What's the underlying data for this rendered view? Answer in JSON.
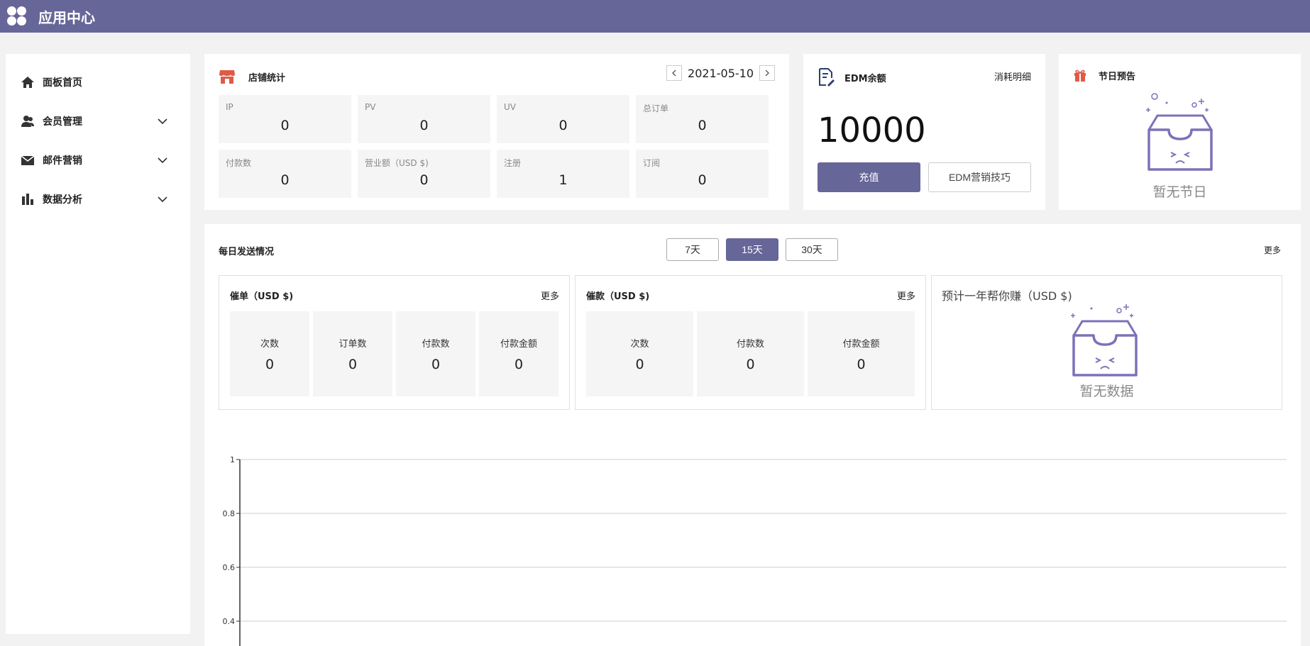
{
  "app": {
    "title": "应用中心"
  },
  "sidebar": {
    "items": [
      {
        "label": "面板首页",
        "icon": "home-icon",
        "expandable": false
      },
      {
        "label": "会员管理",
        "icon": "members-icon",
        "expandable": true
      },
      {
        "label": "邮件营销",
        "icon": "mail-icon",
        "expandable": true
      },
      {
        "label": "数据分析",
        "icon": "bar-chart-icon",
        "expandable": true
      }
    ]
  },
  "store_stats": {
    "title": "店铺统计",
    "date": "2021-05-10",
    "stats": [
      {
        "label": "IP",
        "value": "0"
      },
      {
        "label": "PV",
        "value": "0"
      },
      {
        "label": "UV",
        "value": "0"
      },
      {
        "label": "总订单",
        "value": "0"
      },
      {
        "label": "付款数",
        "value": "0"
      },
      {
        "label": "营业额（USD $)",
        "value": "0"
      },
      {
        "label": "注册",
        "value": "1"
      },
      {
        "label": "订阅",
        "value": "0"
      }
    ]
  },
  "edm": {
    "title": "EDM余额",
    "detail_link": "消耗明细",
    "balance": "10000",
    "recharge_label": "充值",
    "tips_label": "EDM营销技巧"
  },
  "holiday": {
    "title": "节日预告",
    "empty_text": "暂无节日"
  },
  "daily": {
    "title": "每日发送情况",
    "more": "更多",
    "ranges": [
      "7天",
      "15天",
      "30天"
    ],
    "active_range": "15天",
    "reminder": {
      "title": "催单（USD $)",
      "more": "更多",
      "metrics": [
        {
          "label": "次数",
          "value": "0"
        },
        {
          "label": "订单数",
          "value": "0"
        },
        {
          "label": "付款数",
          "value": "0"
        },
        {
          "label": "付款金额",
          "value": "0"
        }
      ]
    },
    "collection": {
      "title": "催款（USD $)",
      "more": "更多",
      "metrics": [
        {
          "label": "次数",
          "value": "0"
        },
        {
          "label": "付款数",
          "value": "0"
        },
        {
          "label": "付款金额",
          "value": "0"
        }
      ]
    },
    "forecast": {
      "title": "预计一年帮你赚（USD $)",
      "empty_text": "暂无数据"
    }
  },
  "colors": {
    "brand": "#666699",
    "icon_red": "#e05a47",
    "icon_navy": "#2c3e70"
  },
  "chart_data": {
    "type": "line",
    "series": [],
    "ylim": [
      0,
      1
    ],
    "yticks": [
      "1",
      "0.8",
      "0.6",
      "0.4"
    ],
    "grid": true
  }
}
